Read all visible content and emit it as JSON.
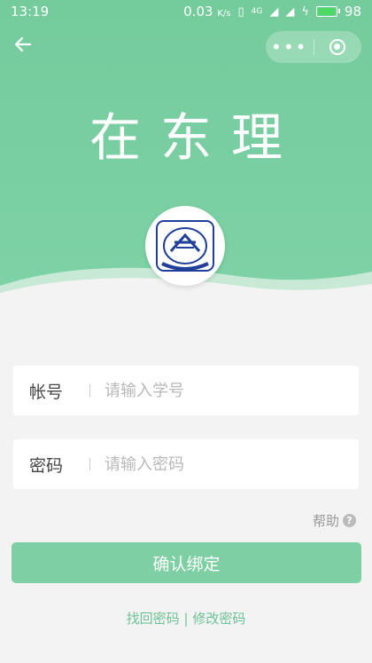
{
  "status_bar": {
    "time": "13:19",
    "speed": "0.03",
    "speed_unit": "K/s",
    "network": "4G",
    "battery": "98",
    "battery_level": 0.98
  },
  "nav": {
    "back_icon": "arrow-left-icon",
    "more_icon": "more-dots-icon",
    "close_icon": "target-close-icon"
  },
  "header": {
    "title": "在东理",
    "logo": "university-emblem"
  },
  "form": {
    "account_label": "帐号",
    "account_placeholder": "请输入学号",
    "password_label": "密码",
    "password_placeholder": "请输入密码",
    "help_label": "帮助",
    "help_icon": "?",
    "confirm_label": "确认绑定"
  },
  "footer": {
    "find_password": "找回密码",
    "separator": "|",
    "change_password": "修改密码"
  },
  "colors": {
    "primary": "#7ed2a6",
    "button": "#7ecfa3",
    "link": "#6cc295"
  }
}
